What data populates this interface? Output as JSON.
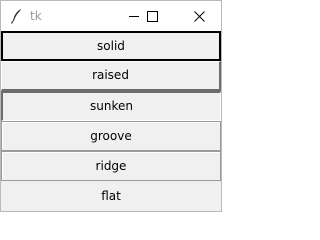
{
  "window": {
    "title": "tk"
  },
  "buttons": [
    {
      "label": "solid",
      "relief": "solid"
    },
    {
      "label": "raised",
      "relief": "raised"
    },
    {
      "label": "sunken",
      "relief": "sunken"
    },
    {
      "label": "groove",
      "relief": "groove"
    },
    {
      "label": "ridge",
      "relief": "ridge"
    },
    {
      "label": "flat",
      "relief": "flat"
    }
  ],
  "icons": {
    "app": "feather-icon",
    "minimize": "minimize-icon",
    "maximize": "maximize-icon",
    "close": "close-icon"
  },
  "colors": {
    "background": "#f0f0f0",
    "titlebar": "#ffffff",
    "text": "#000000"
  }
}
